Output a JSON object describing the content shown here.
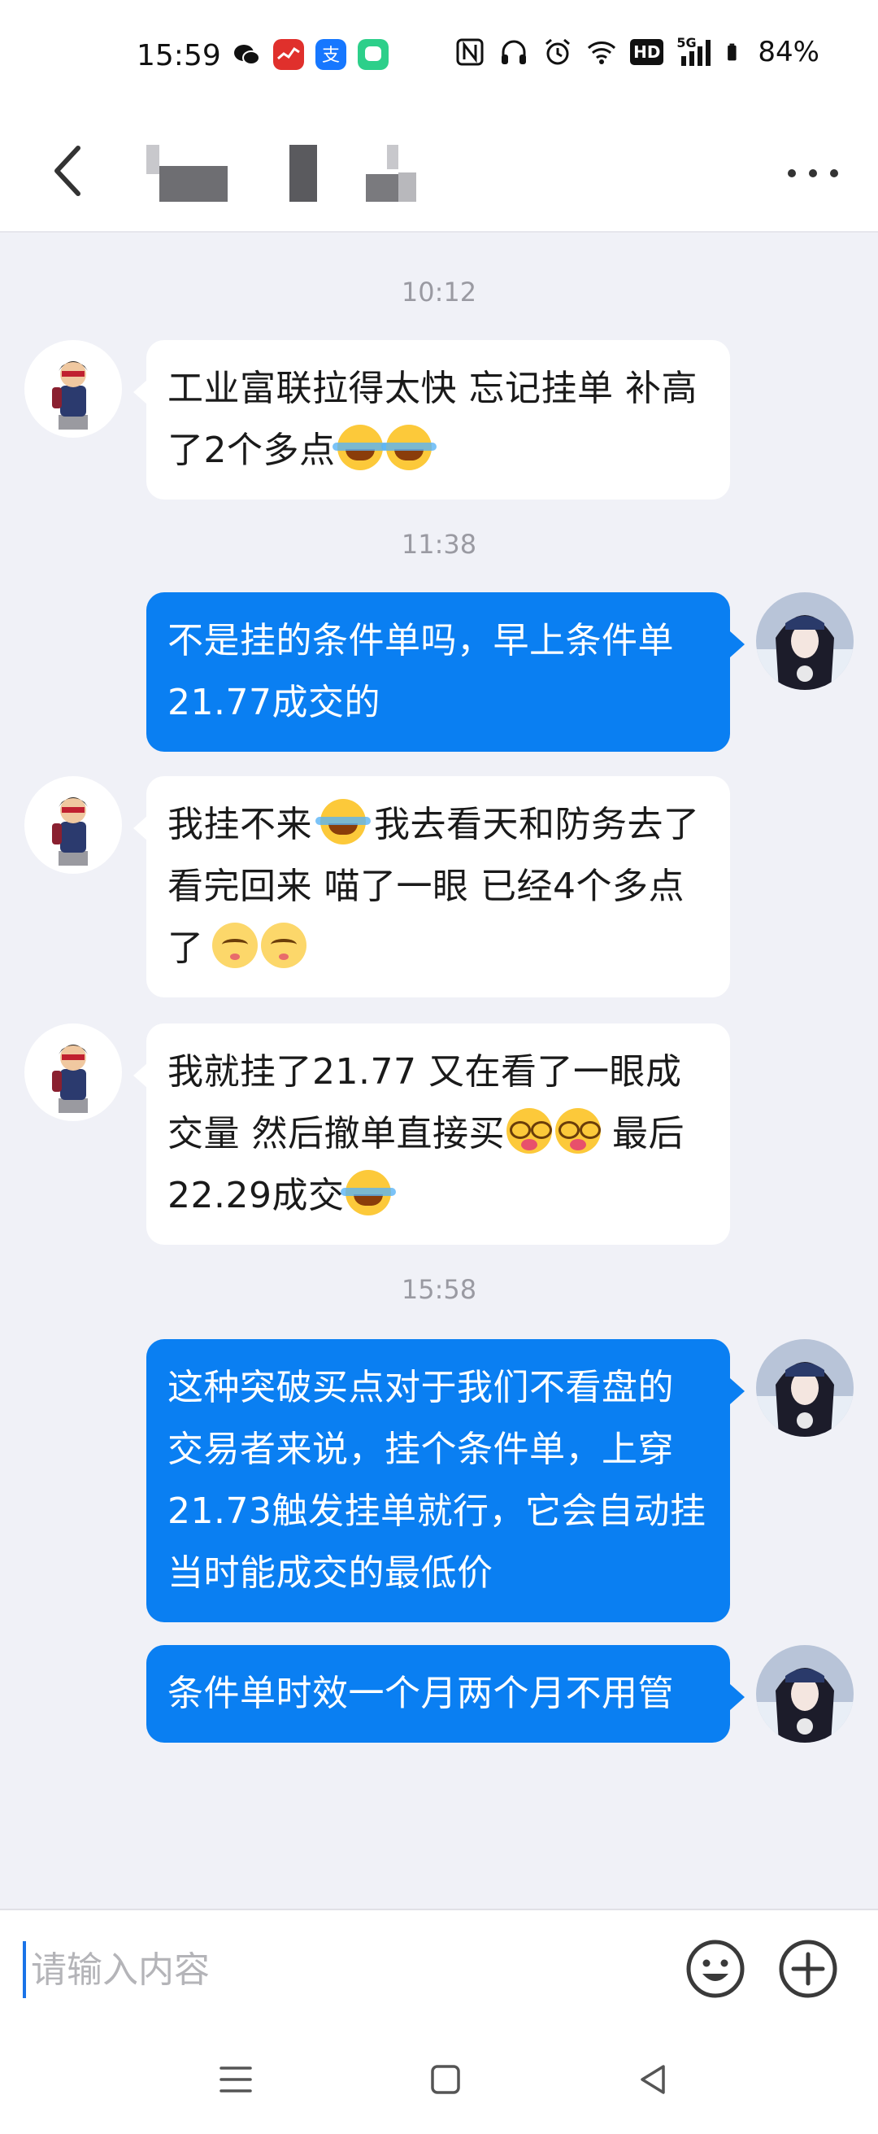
{
  "status_bar": {
    "time": "15:59",
    "battery": "84%",
    "net_badge": "HD",
    "net_type": "5G",
    "icons": [
      "wechat-icon",
      "stock-app-icon",
      "alipay-icon",
      "chat-app-icon",
      "nfc-icon",
      "headphones-icon",
      "alarm-icon",
      "wifi-icon",
      "hd-icon",
      "signal-icon",
      "battery-icon"
    ]
  },
  "header": {
    "back_icon": "chevron-left-icon",
    "more_icon": "more-dots-icon"
  },
  "messages": [
    {
      "type": "timestamp",
      "text": "10:12"
    },
    {
      "type": "incoming",
      "text_1": "工业富联拉得太快 忘记挂单 补高了2个多点"
    },
    {
      "type": "timestamp",
      "text": "11:38"
    },
    {
      "type": "outgoing",
      "text_1": "不是挂的条件单吗，早上条件单21.77成交的"
    },
    {
      "type": "incoming",
      "text_1": "我挂不来",
      "text_2": "我去看天和防务去了 看完回来 喵了一眼 已经4个多点了"
    },
    {
      "type": "incoming",
      "text_1": "我就挂了21.77 又在看了一眼成交量 然后撤单直接买",
      "text_2": "最后22.29成交"
    },
    {
      "type": "timestamp",
      "text": "15:58"
    },
    {
      "type": "outgoing",
      "text_1": "这种突破买点对于我们不看盘的交易者来说，挂个条件单，上穿21.73触发挂单就行，它会自动挂当时能成交的最低价"
    },
    {
      "type": "outgoing",
      "text_1": "条件单时效一个月两个月不用管"
    }
  ],
  "input": {
    "placeholder": "请输入内容",
    "value": ""
  },
  "colors": {
    "outgoing_bubble": "#0a7ff2",
    "incoming_bubble": "#ffffff",
    "chat_bg": "#f0f1f7"
  }
}
